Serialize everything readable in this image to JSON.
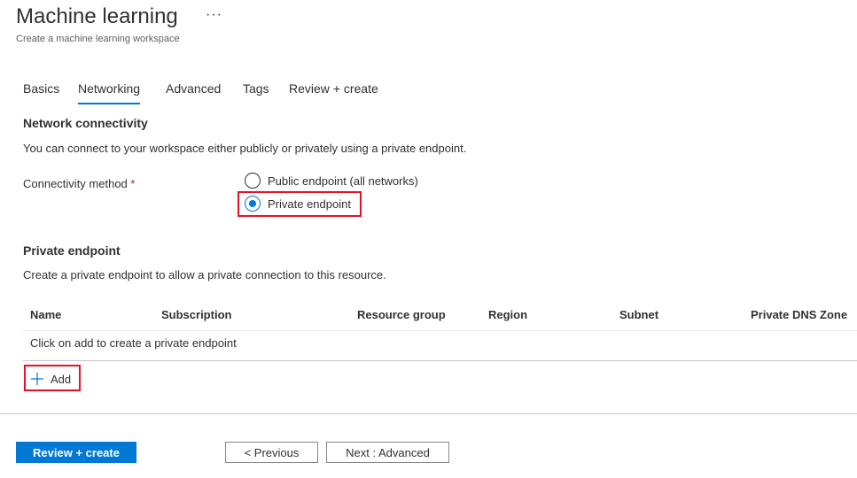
{
  "header": {
    "title": "Machine learning",
    "more_label": "···",
    "subtitle": "Create a machine learning workspace"
  },
  "tabs": [
    {
      "label": "Basics",
      "active": false
    },
    {
      "label": "Networking",
      "active": true
    },
    {
      "label": "Advanced",
      "active": false
    },
    {
      "label": "Tags",
      "active": false
    },
    {
      "label": "Review + create",
      "active": false
    }
  ],
  "network": {
    "section_title": "Network connectivity",
    "description": "You can connect to your workspace either publicly or privately using a private endpoint.",
    "field_label": "Connectivity method",
    "required_marker": "*",
    "options": [
      {
        "label": "Public endpoint (all networks)",
        "selected": false
      },
      {
        "label": "Private endpoint",
        "selected": true
      }
    ]
  },
  "private_endpoint": {
    "section_title": "Private endpoint",
    "description": "Create a private endpoint to allow a private connection to this resource.",
    "columns": [
      "Name",
      "Subscription",
      "Resource group",
      "Region",
      "Subnet",
      "Private DNS Zone"
    ],
    "empty_message": "Click on add to create a private endpoint",
    "add_label": "Add"
  },
  "footer": {
    "review_create_label": "Review + create",
    "previous_label": "< Previous",
    "next_label": "Next : Advanced"
  },
  "colors": {
    "accent": "#0078d4",
    "highlight": "#e81123",
    "required": "#a4262c"
  },
  "icons": {
    "more": "more-icon",
    "add": "plus-icon"
  }
}
